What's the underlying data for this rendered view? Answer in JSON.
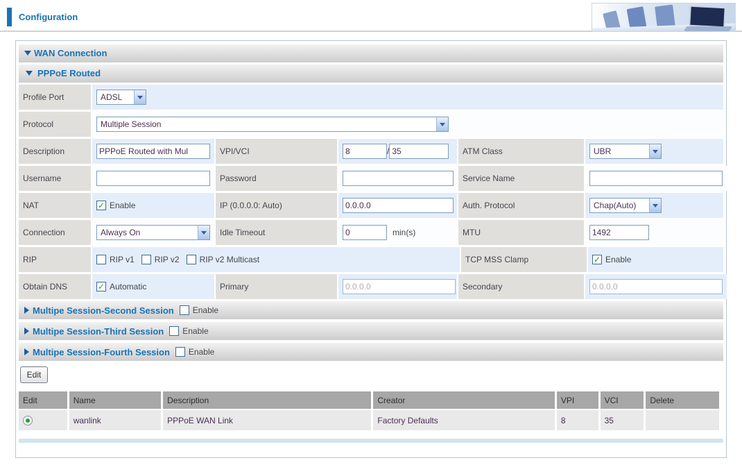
{
  "page": {
    "title": "Configuration"
  },
  "sections": {
    "wan_connection": "WAN Connection",
    "pppoe_routed": "PPPoE Routed"
  },
  "form": {
    "profile_port": {
      "label": "Profile Port",
      "value": "ADSL"
    },
    "protocol": {
      "label": "Protocol",
      "value": "Multiple Session"
    },
    "description": {
      "label": "Description",
      "value": "PPPoE Routed with Mul"
    },
    "vpi_vci": {
      "label": "VPI/VCI",
      "vpi": "8",
      "separator": "/",
      "vci": "35"
    },
    "atm_class": {
      "label": "ATM Class",
      "value": "UBR"
    },
    "username": {
      "label": "Username",
      "value": ""
    },
    "password": {
      "label": "Password",
      "value": ""
    },
    "service_name": {
      "label": "Service Name",
      "value": ""
    },
    "nat": {
      "label": "NAT",
      "checkbox_label": "Enable"
    },
    "ip": {
      "label": "IP (0.0.0.0: Auto)",
      "value": "0.0.0.0"
    },
    "auth_protocol": {
      "label": "Auth. Protocol",
      "value": "Chap(Auto)"
    },
    "connection": {
      "label": "Connection",
      "value": "Always On"
    },
    "idle_timeout": {
      "label": "Idle Timeout",
      "value": "0",
      "unit": "min(s)"
    },
    "mtu": {
      "label": "MTU",
      "value": "1492"
    },
    "rip": {
      "label": "RIP",
      "options": [
        "RIP v1",
        "RIP v2",
        "RIP v2 Multicast"
      ]
    },
    "tcp_mss_clamp": {
      "label": "TCP MSS Clamp",
      "checkbox_label": "Enable"
    },
    "obtain_dns": {
      "label": "Obtain DNS",
      "checkbox_label": "Automatic"
    },
    "primary_dns": {
      "label": "Primary",
      "value": "0.0.0.0"
    },
    "secondary_dns": {
      "label": "Secondary",
      "value": "0.0.0.0"
    }
  },
  "sessions": [
    {
      "title": "Multipe Session-Second Session",
      "checkbox_label": "Enable"
    },
    {
      "title": "Multipe Session-Third Session",
      "checkbox_label": "Enable"
    },
    {
      "title": "Multipe Session-Fourth Session",
      "checkbox_label": "Enable"
    }
  ],
  "buttons": {
    "edit": "Edit"
  },
  "table": {
    "headers": [
      "Edit",
      "Name",
      "Description",
      "Creator",
      "VPI",
      "VCI",
      "Delete"
    ],
    "rows": [
      {
        "name": "wanlink",
        "description": "PPPoE WAN Link",
        "creator": "Factory Defaults",
        "vpi": "8",
        "vci": "35",
        "delete": ""
      }
    ]
  },
  "colors": {
    "accent_blue": "#1973b5",
    "check_green": "#2f9e2f",
    "label_gray": "#e1dfdc",
    "row_blue": "#e4eefa"
  }
}
